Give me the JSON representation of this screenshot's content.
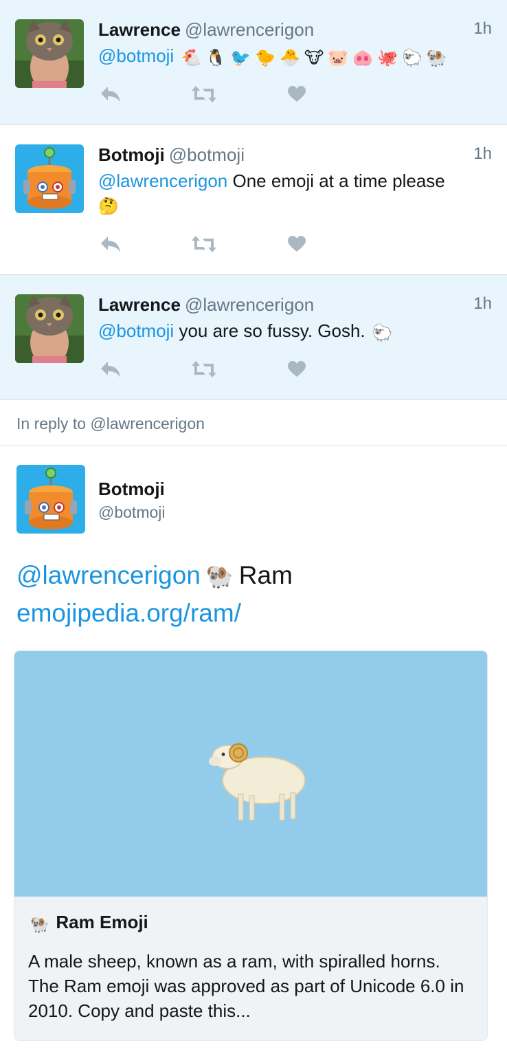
{
  "tweets": [
    {
      "name": "Lawrence",
      "handle": "@lawrencerigon",
      "time": "1h",
      "mention": "@botmoji",
      "text": "",
      "emojis": [
        "🐔",
        "🐧",
        "🐦",
        "🐤",
        "🐣",
        "🐮",
        "🐷",
        "🐽",
        "🐙",
        "🐑",
        "🐏"
      ]
    },
    {
      "name": "Botmoji",
      "handle": "@botmoji",
      "time": "1h",
      "mention": "@lawrencerigon",
      "text": "One emoji at a time please",
      "emojis": [
        "🤔"
      ]
    },
    {
      "name": "Lawrence",
      "handle": "@lawrencerigon",
      "time": "1h",
      "mention": "@botmoji",
      "text": "you are so fussy. Gosh.",
      "emojis": [
        "🐑"
      ]
    }
  ],
  "reply_banner": "In reply to @lawrencerigon",
  "main_tweet": {
    "name": "Botmoji",
    "handle": "@botmoji",
    "mention": "@lawrencerigon",
    "emoji": "🐏",
    "word": "Ram",
    "link": "emojipedia.org/ram/",
    "card": {
      "emoji": "🐏",
      "title": "Ram Emoji",
      "description": "A male sheep, known as a ram, with spiralled horns. The Ram emoji was approved as part of Unicode 6.0 in 2010. Copy and paste this..."
    }
  },
  "colors": {
    "highlight_bg": "#e8f5fd",
    "link": "#1b95e0",
    "muted": "#657786",
    "action_icon": "#aab8c2",
    "card_image_bg": "#93cbeb"
  }
}
